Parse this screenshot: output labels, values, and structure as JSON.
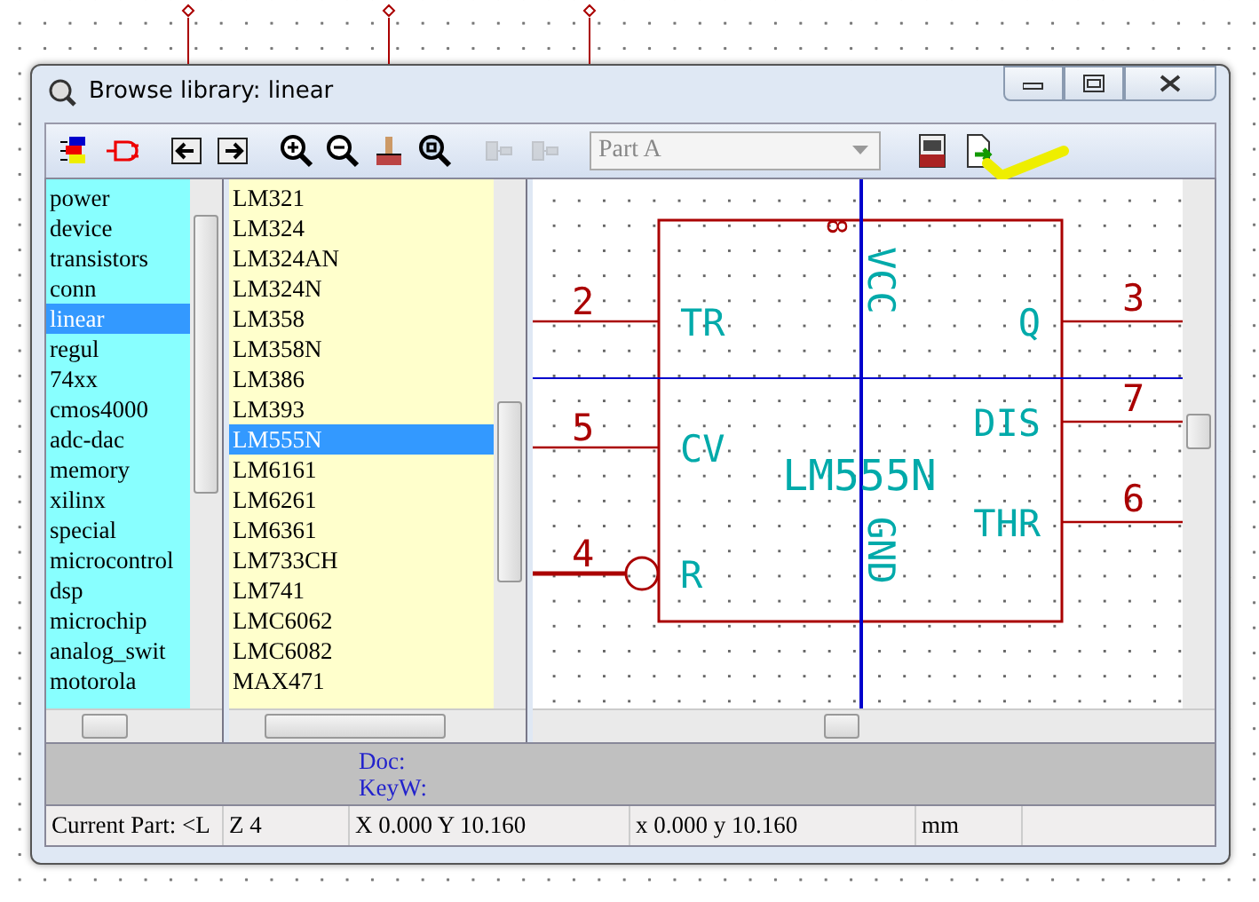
{
  "window": {
    "title": "Browse library: linear"
  },
  "toolbar": {
    "items": [
      {
        "kind": "libs",
        "disabled": false
      },
      {
        "kind": "plug",
        "disabled": false
      },
      {
        "kind": "prev",
        "disabled": false
      },
      {
        "kind": "next",
        "disabled": false
      },
      {
        "kind": "zoomin",
        "disabled": false
      },
      {
        "kind": "zoomout",
        "disabled": false
      },
      {
        "kind": "brush",
        "disabled": false
      },
      {
        "kind": "zoomfit",
        "disabled": false
      },
      {
        "kind": "convert",
        "disabled": true
      },
      {
        "kind": "convert",
        "disabled": true
      }
    ],
    "part_select": {
      "value": "Part A",
      "disabled": true
    },
    "after": [
      {
        "kind": "pdf",
        "disabled": false
      },
      {
        "kind": "export",
        "disabled": false
      }
    ]
  },
  "libraries": [
    {
      "label": "power",
      "selected": false
    },
    {
      "label": "device",
      "selected": false
    },
    {
      "label": "transistors",
      "selected": false
    },
    {
      "label": "conn",
      "selected": false
    },
    {
      "label": "linear",
      "selected": true
    },
    {
      "label": "regul",
      "selected": false
    },
    {
      "label": "74xx",
      "selected": false
    },
    {
      "label": "cmos4000",
      "selected": false
    },
    {
      "label": "adc-dac",
      "selected": false
    },
    {
      "label": "memory",
      "selected": false
    },
    {
      "label": "xilinx",
      "selected": false
    },
    {
      "label": "special",
      "selected": false
    },
    {
      "label": "microcontrol",
      "selected": false
    },
    {
      "label": "dsp",
      "selected": false
    },
    {
      "label": "microchip",
      "selected": false
    },
    {
      "label": "analog_swit",
      "selected": false
    },
    {
      "label": "motorola",
      "selected": false
    }
  ],
  "parts": [
    {
      "label": "LM321",
      "selected": false
    },
    {
      "label": "LM324",
      "selected": false
    },
    {
      "label": "LM324AN",
      "selected": false
    },
    {
      "label": "LM324N",
      "selected": false
    },
    {
      "label": "LM358",
      "selected": false
    },
    {
      "label": "LM358N",
      "selected": false
    },
    {
      "label": "LM386",
      "selected": false
    },
    {
      "label": "LM393",
      "selected": false
    },
    {
      "label": "LM555N",
      "selected": true
    },
    {
      "label": "LM6161",
      "selected": false
    },
    {
      "label": "LM6261",
      "selected": false
    },
    {
      "label": "LM6361",
      "selected": false
    },
    {
      "label": "LM733CH",
      "selected": false
    },
    {
      "label": "LM741",
      "selected": false
    },
    {
      "label": "LMC6062",
      "selected": false
    },
    {
      "label": "LMC6082",
      "selected": false
    },
    {
      "label": "MAX471",
      "selected": false
    }
  ],
  "schematic": {
    "name": "LM555N",
    "left_pins": [
      {
        "number": "2",
        "name": "TR",
        "kind": "line"
      },
      {
        "number": "5",
        "name": "CV",
        "kind": "line"
      },
      {
        "number": "4",
        "name": "R",
        "kind": "inverted"
      }
    ],
    "right_pins": [
      {
        "number": "3",
        "name": "Q"
      },
      {
        "number": "7",
        "name": "DIS"
      },
      {
        "number": "6",
        "name": "THR"
      }
    ],
    "top_pin": {
      "number": "8",
      "name": "VCC"
    },
    "bottom_pin": {
      "name": "GND"
    }
  },
  "info": {
    "doc": "Doc:",
    "keywords": "KeyW:"
  },
  "status_bar": [
    "Current Part: <L",
    "Z 4",
    "X 0.000  Y 10.160",
    "x 0.000  y 10.160",
    "mm"
  ]
}
